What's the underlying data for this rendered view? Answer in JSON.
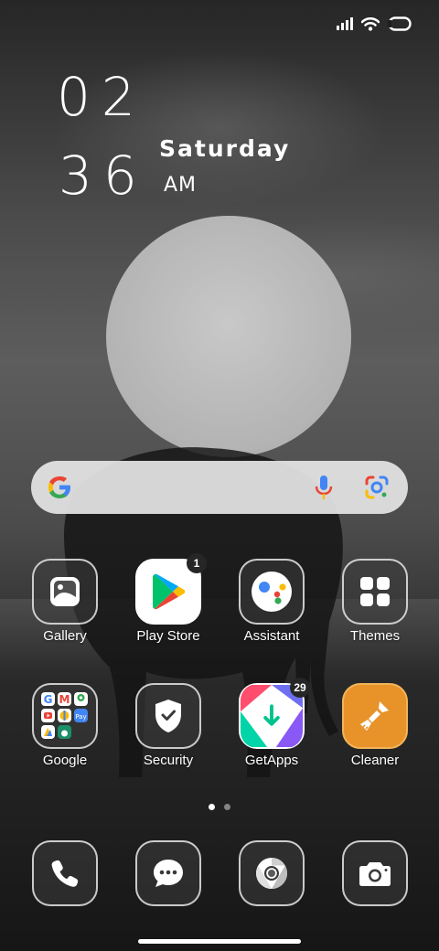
{
  "clock": {
    "hours": "02",
    "minutes": "36",
    "day": "Saturday",
    "ampm": "AM"
  },
  "status_bar": {
    "icons": [
      "signal-icon",
      "wifi-icon",
      "battery-icon"
    ]
  },
  "search": {
    "icons": [
      "google-g-icon",
      "microphone-icon",
      "google-lens-icon"
    ]
  },
  "apps": [
    {
      "label": "Gallery",
      "icon": "gallery-icon"
    },
    {
      "label": "Play Store",
      "icon": "play-store-icon",
      "badge": "1"
    },
    {
      "label": "Assistant",
      "icon": "assistant-icon"
    },
    {
      "label": "Themes",
      "icon": "themes-icon"
    },
    {
      "label": "Google",
      "icon": "google-folder-icon"
    },
    {
      "label": "Security",
      "icon": "security-shield-icon"
    },
    {
      "label": "GetApps",
      "icon": "getapps-icon",
      "badge": "29"
    },
    {
      "label": "Cleaner",
      "icon": "cleaner-brush-icon"
    }
  ],
  "dock": [
    {
      "icon": "phone-icon"
    },
    {
      "icon": "messages-icon"
    },
    {
      "icon": "chrome-icon"
    },
    {
      "icon": "camera-icon"
    }
  ],
  "page_indicator": {
    "pages": 2,
    "current": 1
  },
  "colors": {
    "accent_orange": "#e8932a",
    "play_green": "#00c26a",
    "google_blue": "#4285f4",
    "google_red": "#ea4335",
    "google_yellow": "#fbbc05",
    "google_green": "#34a853"
  }
}
